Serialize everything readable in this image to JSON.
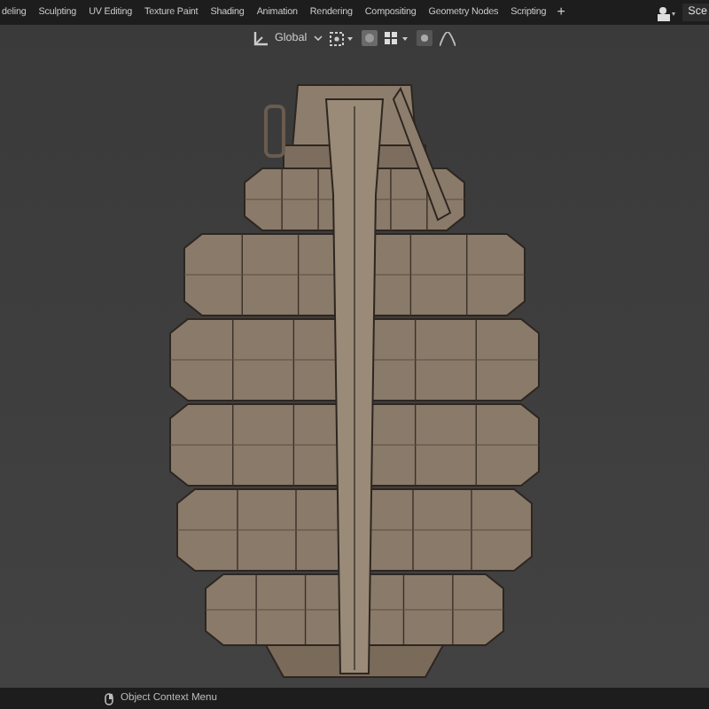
{
  "workspace_tabs": [
    {
      "label": "deling",
      "selected": false
    },
    {
      "label": "Sculpting",
      "selected": false
    },
    {
      "label": "UV Editing",
      "selected": false
    },
    {
      "label": "Texture Paint",
      "selected": false
    },
    {
      "label": "Shading",
      "selected": false
    },
    {
      "label": "Animation",
      "selected": false
    },
    {
      "label": "Rendering",
      "selected": false
    },
    {
      "label": "Compositing",
      "selected": false
    },
    {
      "label": "Geometry Nodes",
      "selected": false
    },
    {
      "label": "Scripting",
      "selected": false
    }
  ],
  "add_tab": "+",
  "scene": {
    "label": "Sce"
  },
  "viewport_header": {
    "orientation": "Global"
  },
  "status_bar": {
    "hint": "Object Context Menu"
  }
}
